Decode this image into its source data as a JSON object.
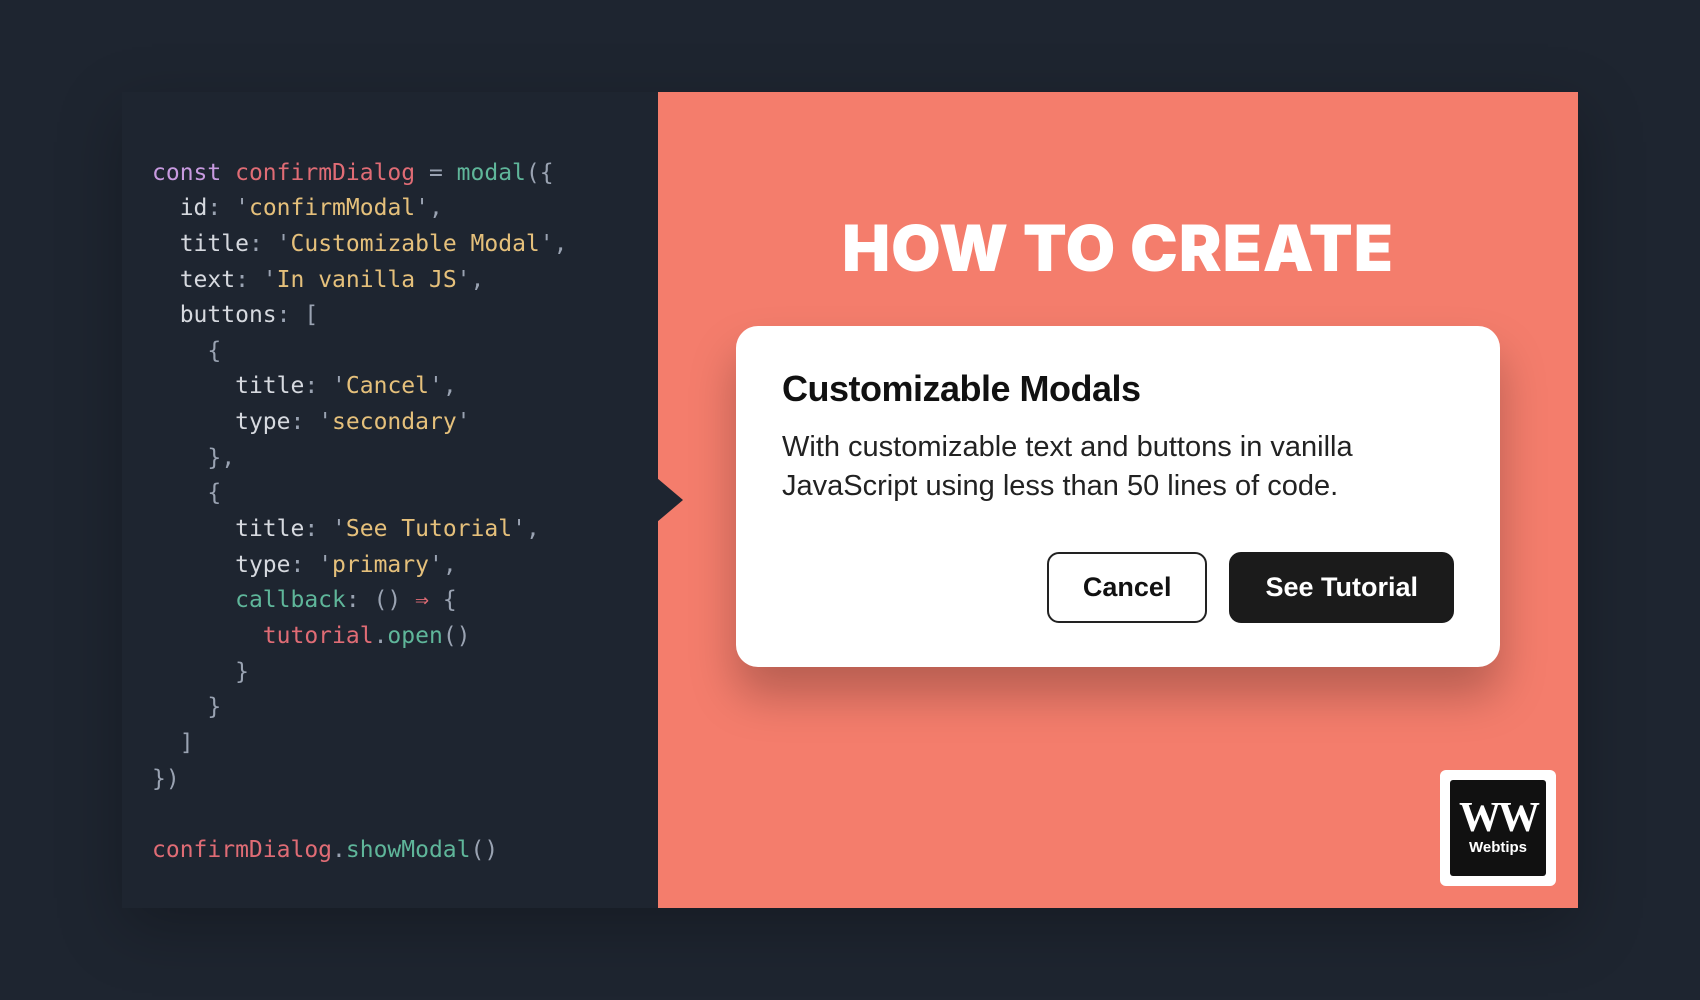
{
  "code": {
    "l1": {
      "kw": "const",
      "var": "confirmDialog",
      "eq": " = ",
      "fn": "modal",
      "open": "({"
    },
    "l2": {
      "indent": "  ",
      "prop": "id",
      "colon": ": ",
      "q1": "'",
      "str": "confirmModal",
      "q2": "'",
      "comma": ","
    },
    "l3": {
      "indent": "  ",
      "prop": "title",
      "colon": ": ",
      "q1": "'",
      "str": "Customizable Modal",
      "q2": "'",
      "comma": ","
    },
    "l4": {
      "indent": "  ",
      "prop": "text",
      "colon": ": ",
      "q1": "'",
      "str": "In vanilla JS",
      "q2": "'",
      "comma": ","
    },
    "l5": {
      "indent": "  ",
      "prop": "buttons",
      "colon": ": [",
      "open": ""
    },
    "l6": {
      "indent": "    ",
      "brace": "{"
    },
    "l7": {
      "indent": "      ",
      "prop": "title",
      "colon": ": ",
      "q1": "'",
      "str": "Cancel",
      "q2": "'",
      "comma": ","
    },
    "l8": {
      "indent": "      ",
      "prop": "type",
      "colon": ": ",
      "q1": "'",
      "str": "secondary",
      "q2": "'"
    },
    "l9": {
      "indent": "    ",
      "brace": "},"
    },
    "l10": {
      "indent": "    ",
      "brace": "{"
    },
    "l11": {
      "indent": "      ",
      "prop": "title",
      "colon": ": ",
      "q1": "'",
      "str": "See Tutorial",
      "q2": "'",
      "comma": ","
    },
    "l12": {
      "indent": "      ",
      "prop": "type",
      "colon": ": ",
      "q1": "'",
      "str": "primary",
      "q2": "'",
      "comma": ","
    },
    "l13": {
      "indent": "      ",
      "prop": "callback",
      "colon": ": () ",
      "arrow": "⇒",
      "rest": " {"
    },
    "l14": {
      "indent": "        ",
      "obj": "tutorial",
      "dot": ".",
      "fn": "open",
      "paren": "()"
    },
    "l15": {
      "indent": "      ",
      "brace": "}"
    },
    "l16": {
      "indent": "    ",
      "brace": "}"
    },
    "l17": {
      "indent": "  ",
      "brace": "]"
    },
    "l18": {
      "indent": "",
      "brace": "})"
    },
    "l20": {
      "obj": "confirmDialog",
      "dot": ".",
      "fn": "showModal",
      "paren": "()"
    }
  },
  "hero": {
    "headline": "HOW TO CREATE"
  },
  "modal": {
    "title": "Customizable Modals",
    "text": "With customizable text and buttons in vanilla JavaScript using less than 50 lines of code.",
    "buttons": {
      "secondary": "Cancel",
      "primary": "See Tutorial"
    }
  },
  "logo": {
    "mark": "WW",
    "name": "Webtips"
  }
}
